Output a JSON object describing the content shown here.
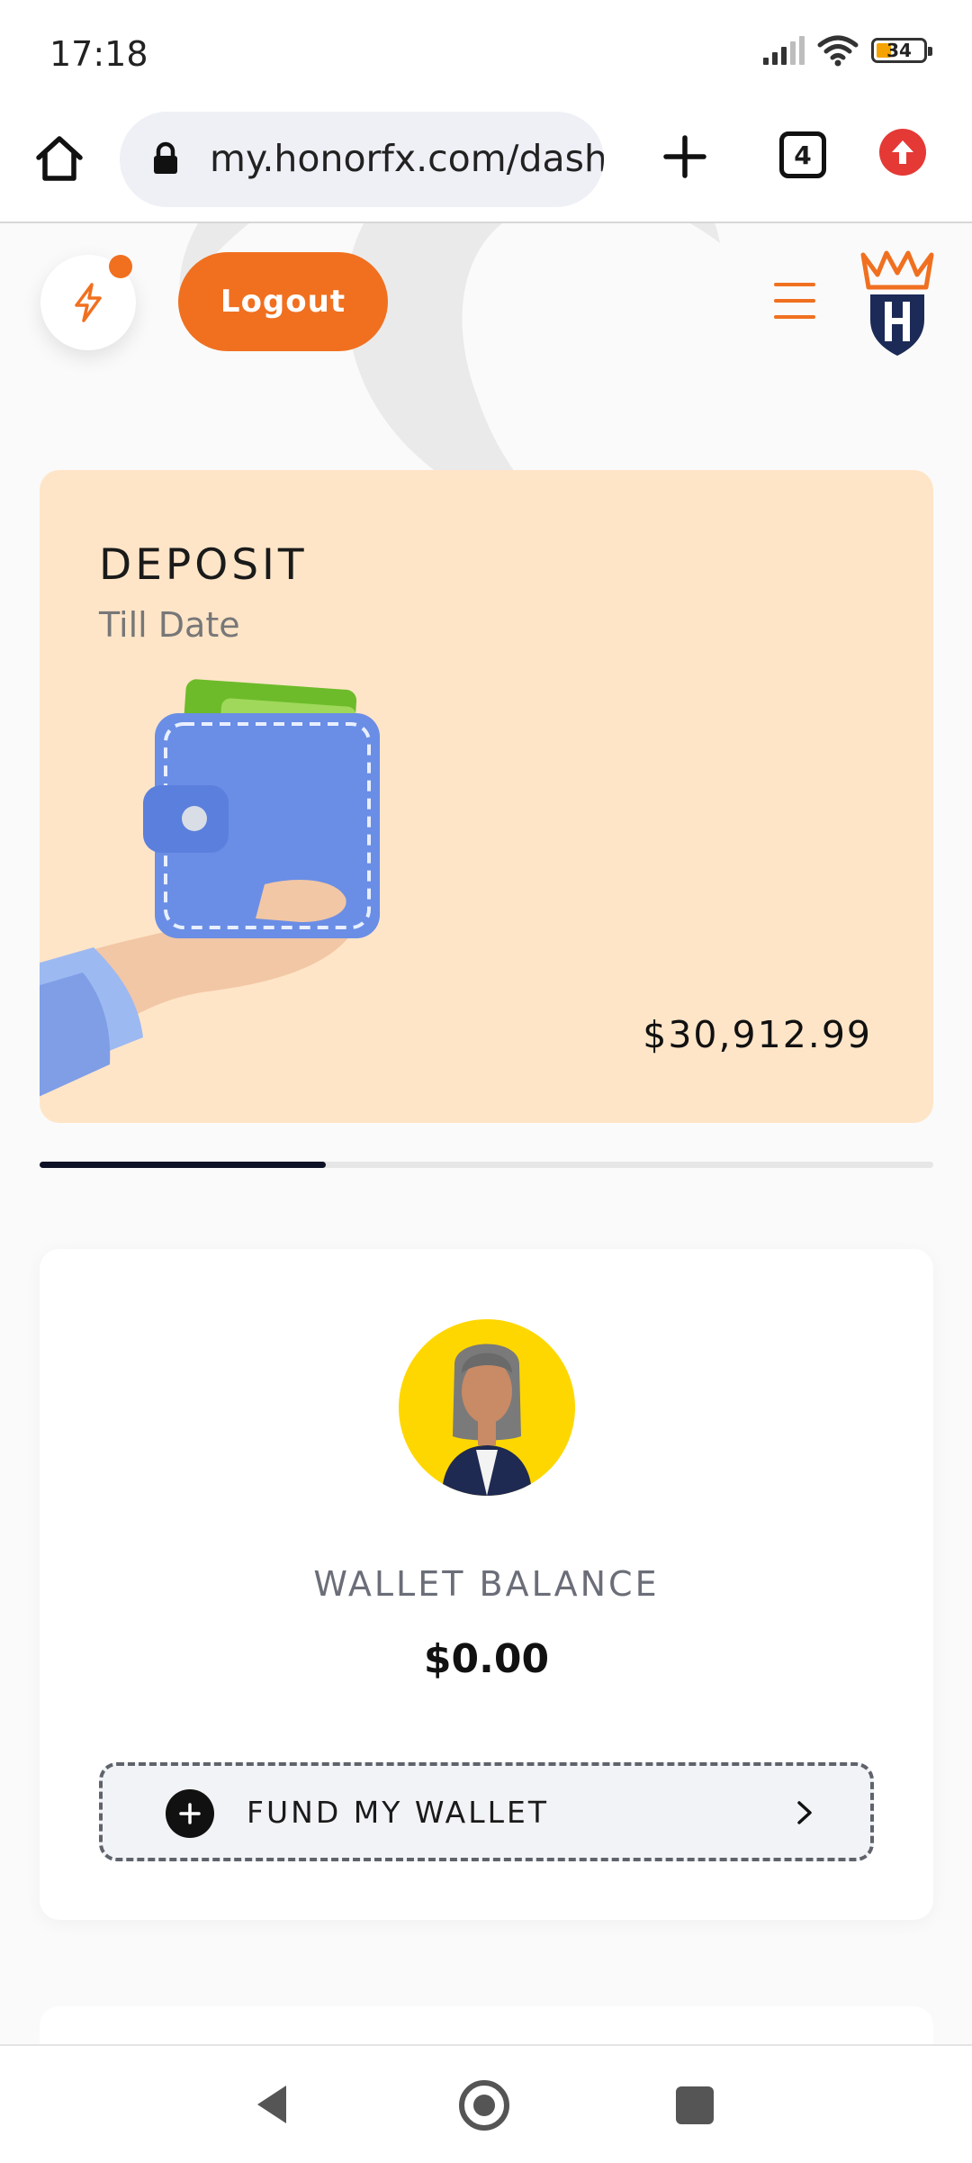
{
  "status_bar": {
    "time": "17:18",
    "battery_level": "34",
    "icons": [
      "signal-icon",
      "wifi-icon",
      "battery-icon"
    ]
  },
  "browser": {
    "url": "my.honorfx.com/dash",
    "tab_count": "4",
    "icons": [
      "home-icon",
      "lock-icon",
      "new-tab-icon",
      "tabs-icon",
      "update-icon"
    ]
  },
  "header": {
    "logout_label": "Logout",
    "icons": [
      "flash-icon",
      "menu-icon",
      "honorfx-logo"
    ],
    "notification_color": "#f07020"
  },
  "deposit_card": {
    "title": "DEPOSIT",
    "subtitle": "Till Date",
    "amount": "$30,912.99",
    "background_color": "#ffe5c8",
    "illustration": "hand-holding-wallet"
  },
  "carousel": {
    "progress": 0.32
  },
  "wallet_card": {
    "label": "WALLET BALANCE",
    "amount": "$0.00",
    "fund_button_label": "FUND MY WALLET",
    "avatar_background": "#ffd700",
    "icons": [
      "plus-icon",
      "chevron-right-icon"
    ]
  },
  "nav_bar": {
    "buttons": [
      "back-icon",
      "home-icon",
      "recents-icon"
    ]
  },
  "theme": {
    "accent": "#f07020",
    "dark": "#0f1226"
  }
}
